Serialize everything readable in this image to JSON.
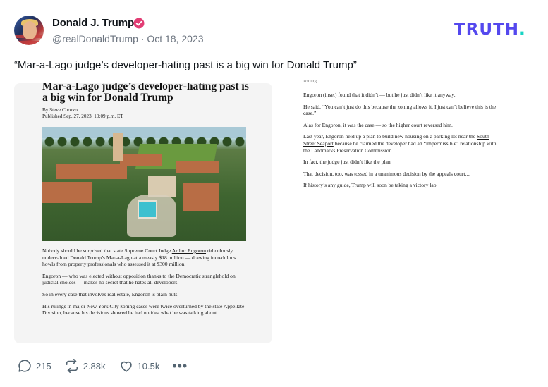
{
  "author": {
    "name": "Donald J. Trump",
    "handle": "@realDonaldTrump",
    "separator": "·",
    "date": "Oct 18, 2023",
    "verified_color": "#e23d74"
  },
  "brand": {
    "logo_text": "TRUTH",
    "logo_dot": ".",
    "logo_color": "#5448ee",
    "dot_color": "#17d4c4"
  },
  "post": {
    "text": "“Mar-a-Lago judge’s developer-hating past is a big win for Donald Trump”"
  },
  "article": {
    "headline": "Mar-a-Lago judge’s developer-hating past is a big win for Donald Trump",
    "byline": "By Steve Cuozzo",
    "published": "Published Sep. 27, 2023, 10:09 p.m. ET",
    "image_description_icon": "aerial-estate-photo",
    "left_paragraphs": [
      {
        "pre": "Nobody should be surprised that state Supreme Court Judge ",
        "link": "Arthur Engoron",
        "post": " ridiculously undervalued Donald Trump’s Mar-a-Lago at a measly $18 million — drawing incredulous howls from property professionals who assessed it at $300 million."
      },
      {
        "pre": "Engoron — who was elected without opposition thanks to the Democratic stranglehold on judicial choices — makes no secret that he hates all developers.",
        "link": "",
        "post": ""
      },
      {
        "pre": "So in every case that involves real estate, Engoron is plain nuts.",
        "link": "",
        "post": ""
      },
      {
        "pre": "His rulings in major New York City zoning cases were twice overturned by the state Appellate Division, because his decisions showed he had no idea what he was talking about.",
        "link": "",
        "post": ""
      }
    ],
    "right_cutoff": "zoning.",
    "right_paragraphs": [
      {
        "pre": "Engoron (inset) found that it didn’t — but he just didn’t like it anyway.",
        "link": "",
        "post": ""
      },
      {
        "pre": "He said, “You can’t just do this because the zoning allows it. I just can’t believe this is the case.”",
        "link": "",
        "post": ""
      },
      {
        "pre": "Alas for Engoron, it was the case — so the higher court reversed him.",
        "link": "",
        "post": ""
      },
      {
        "pre": "Last year, Engoron held up a plan to build new housing on a parking lot near the ",
        "link": "South Street Seaport",
        "post": " because he claimed the developer had an “impermissible” relationship with the Landmarks Preservation Commission."
      },
      {
        "pre": "In fact, the judge just didn’t like the plan.",
        "link": "",
        "post": ""
      },
      {
        "pre": "That decision, too, was tossed in a unanimous decision by the appeals court....",
        "link": "",
        "post": ""
      },
      {
        "pre": "If history’s any guide, Trump will soon be taking a victory lap.",
        "link": "",
        "post": ""
      }
    ]
  },
  "actions": {
    "reply_count": "215",
    "retruth_count": "2.88k",
    "like_count": "10.5k",
    "more_label": "•••"
  }
}
